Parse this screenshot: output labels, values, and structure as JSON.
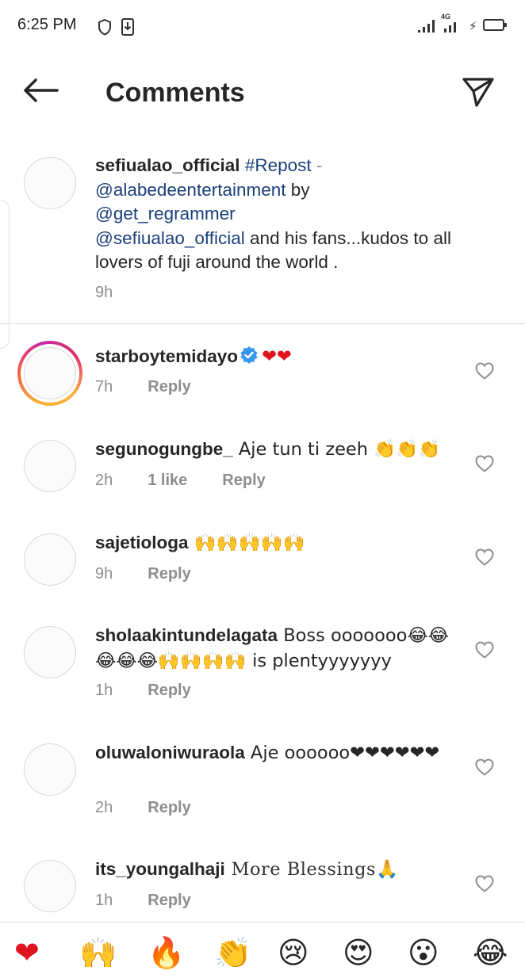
{
  "status_bar": {
    "time": "6:25 PM",
    "network_badge": "4G"
  },
  "header": {
    "title": "Comments",
    "back_icon": "arrow-left-icon",
    "send_icon": "paper-plane-icon"
  },
  "caption": {
    "username": "sefiualao_official",
    "hashtag": "#Repost",
    "dash": " -",
    "mention1": "@alabedeentertainment",
    "by": " by",
    "mention2": "@get_regrammer",
    "mention3": "@sefiualao_official",
    "text": " and his fans...kudos to all lovers of fuji around the world .",
    "time": "9h"
  },
  "comments": [
    {
      "username": "starboytemidayo",
      "verified": true,
      "text": "❤❤",
      "time": "7h",
      "likes": "",
      "reply": "Reply",
      "story_ring": true
    },
    {
      "username": "segunogungbe_",
      "text": " Aje tun ti zeeh 👏👏👏",
      "time": "2h",
      "likes": "1 like",
      "reply": "Reply"
    },
    {
      "username": "sajetiologa",
      "text": " 🙌🙌🙌🙌🙌",
      "time": "9h",
      "likes": "",
      "reply": "Reply"
    },
    {
      "username": "sholaakintundelagata",
      "text": " Boss ooooooo😂😂😂😂😂🙌🙌🙌🙌 is plentyyyyyyy",
      "time": "1h",
      "likes": "",
      "reply": "Reply"
    },
    {
      "username": "oluwaloniwuraola",
      "text": " Aje oooooo❤❤❤❤❤❤",
      "time": "2h",
      "likes": "",
      "reply": "Reply"
    },
    {
      "username": "its_youngalhaji",
      "text": " More Blessings🙏",
      "time": "1h",
      "likes": "",
      "reply": "Reply"
    }
  ],
  "reactions": [
    "❤",
    "🙌",
    "🔥",
    "👏",
    "😢",
    "😍",
    "😮",
    "😂"
  ],
  "colors": {
    "link": "#1b3f7c",
    "muted": "#8e8e8e",
    "heart_red": "#e0141e",
    "verified_blue": "#3897f0"
  }
}
